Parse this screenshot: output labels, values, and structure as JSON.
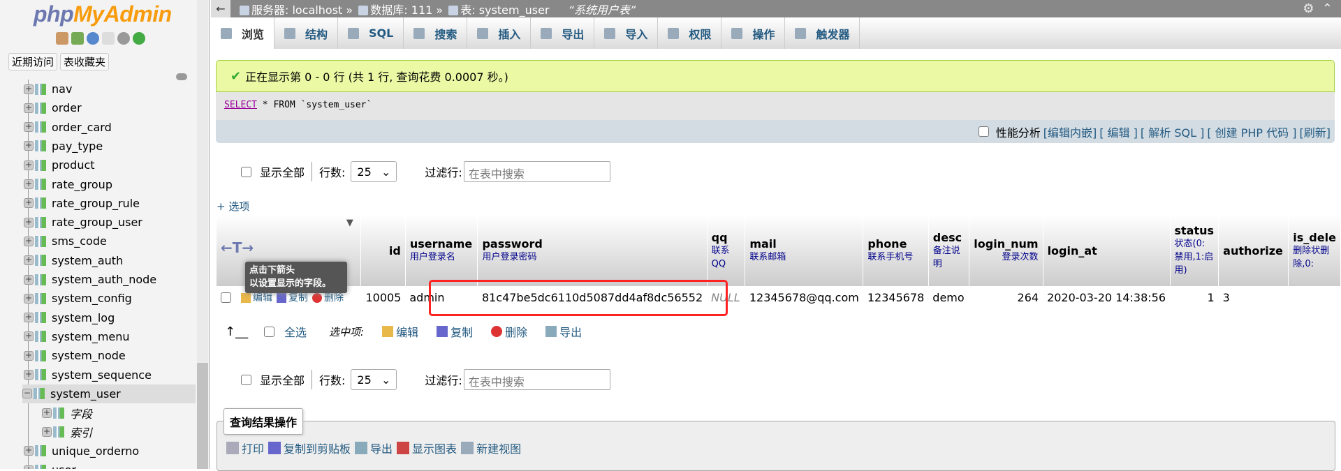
{
  "sidebar": {
    "logo": {
      "php": "php",
      "myadmin": "MyAdmin"
    },
    "recent": "近期访问",
    "favorites": "表收藏夹",
    "tables": [
      "nav",
      "order",
      "order_card",
      "pay_type",
      "product",
      "rate_group",
      "rate_group_rule",
      "rate_group_user",
      "sms_code",
      "system_auth",
      "system_auth_node",
      "system_config",
      "system_log",
      "system_menu",
      "system_node",
      "system_sequence",
      "system_user",
      "unique_orderno",
      "user"
    ],
    "selected": "system_user",
    "children": [
      "字段",
      "索引"
    ]
  },
  "breadcrumb": {
    "server": "服务器: localhost",
    "db": "数据库: 111",
    "table": "表: system_user",
    "comment": "“系统用户表”"
  },
  "tabs": [
    "浏览",
    "结构",
    "SQL",
    "搜索",
    "插入",
    "导出",
    "导入",
    "权限",
    "操作",
    "触发器"
  ],
  "message": "正在显示第 0 - 0 行 (共 1 行, 查询花费 0.0007 秒。)",
  "sql": {
    "kw": "SELECT",
    "rest": " * FROM `system_user`"
  },
  "sql_toolbar": {
    "profiling": "性能分析",
    "links": [
      "[编辑内嵌]",
      "[ 编辑 ]",
      "[ 解析 SQL ]",
      "[ 创建 PHP 代码 ]",
      "[刷新]"
    ]
  },
  "nav": {
    "show_all": "显示全部",
    "rows_label": "行数:",
    "rows_value": "25",
    "filter_label": "过滤行:",
    "filter_placeholder": "在表中搜索"
  },
  "options": "+ 选项",
  "tooltip": [
    "点击下箭头",
    "以设置显示的字段。"
  ],
  "columns": [
    {
      "name": "id",
      "comment": ""
    },
    {
      "name": "username",
      "comment": "用户登录名"
    },
    {
      "name": "password",
      "comment": "用户登录密码"
    },
    {
      "name": "qq",
      "comment": "联系QQ"
    },
    {
      "name": "mail",
      "comment": "联系邮箱"
    },
    {
      "name": "phone",
      "comment": "联系手机号"
    },
    {
      "name": "desc",
      "comment": "备注说明"
    },
    {
      "name": "login_num",
      "comment": "登录次数"
    },
    {
      "name": "login_at",
      "comment": ""
    },
    {
      "name": "status",
      "comment": "状态(0:禁用,1:启用)"
    },
    {
      "name": "authorize",
      "comment": ""
    },
    {
      "name": "is_dele",
      "comment": "删除状删除,0:"
    }
  ],
  "row_actions": {
    "edit": "编辑",
    "copy": "复制",
    "delete": "删除"
  },
  "rows": [
    [
      "10005",
      "admin",
      "81c47be5dc6110d5087dd4af8dc56552",
      "NULL",
      "12345678@qq.com",
      "12345678",
      "demo",
      "264",
      "2020-03-20 14:38:56",
      "1",
      "3",
      ""
    ]
  ],
  "bulk": {
    "check_all": "全选",
    "with_selected": "选中项:",
    "edit": "编辑",
    "copy": "复制",
    "delete": "删除",
    "export": "导出"
  },
  "query_ops": {
    "title": "查询结果操作",
    "items": [
      "打印",
      "复制到剪贴板",
      "导出",
      "显示图表",
      "新建视图"
    ]
  },
  "highlight_color": "#ff2222"
}
